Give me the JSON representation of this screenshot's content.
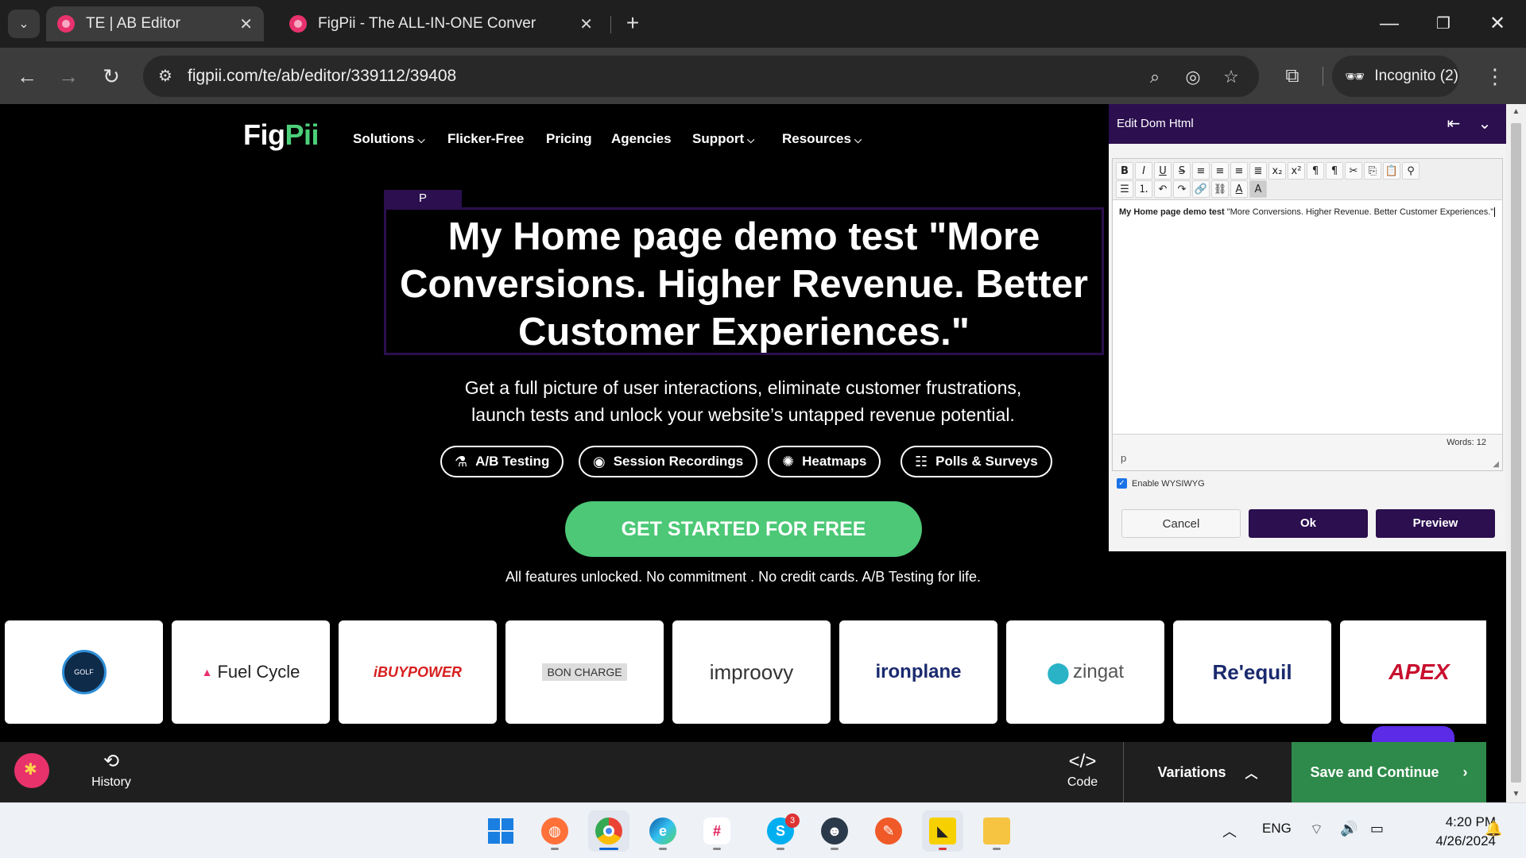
{
  "browser": {
    "tabs": [
      {
        "title": "TE | AB Editor",
        "active": true
      },
      {
        "title": "FigPii - The ALL-IN-ONE Conver",
        "active": false
      }
    ],
    "url": "figpii.com/te/ab/editor/339112/39408",
    "profile_label": "Incognito (2)"
  },
  "site": {
    "logo_fig": "Fig",
    "logo_pii": "Pii",
    "nav": [
      "Solutions",
      "Flicker-Free",
      "Pricing",
      "Agencies",
      "Support",
      "Resources"
    ],
    "selected_tag": "P",
    "headline": "My Home page demo test \"More Conversions. Higher Revenue. Better Customer Experiences.\"",
    "subhead_line1": "Get a full picture of user interactions, eliminate customer frustrations,",
    "subhead_line2": "launch tests and unlock your website’s untapped revenue potential.",
    "features": [
      {
        "label": "A/B Testing",
        "icon": "flask-icon"
      },
      {
        "label": "Session Recordings",
        "icon": "record-icon"
      },
      {
        "label": "Heatmaps",
        "icon": "heatmap-icon"
      },
      {
        "label": "Polls & Surveys",
        "icon": "survey-icon"
      }
    ],
    "cta": "GET STARTED FOR FREE",
    "cta_note": "All features unlocked. No commitment . No credit cards. A/B Testing for life.",
    "client_logos": [
      {
        "text": "GOLF"
      },
      {
        "text": "Fuel Cycle"
      },
      {
        "text": "iBUYPOWER"
      },
      {
        "text": "BON CHARGE"
      },
      {
        "text": "improovy"
      },
      {
        "text": "ironplane"
      },
      {
        "text": "zingat"
      },
      {
        "text": "Re'equil"
      },
      {
        "text": "APEX"
      }
    ]
  },
  "panel": {
    "title": "Edit Dom Html",
    "content_bold": "My Home page demo test",
    "content_rest": " \"More Conversions. Higher Revenue. Better Customer Experiences.\"",
    "path": "p",
    "words": "Words: 12",
    "wysiwyg_label": "Enable WYSIWYG",
    "cancel": "Cancel",
    "ok": "Ok",
    "preview": "Preview"
  },
  "editbar": {
    "history": "History",
    "code": "Code",
    "variations": "Variations",
    "save": "Save and Continue"
  },
  "taskbar": {
    "lang": "ENG",
    "time": "4:20 PM",
    "date": "4/26/2024",
    "skype_badge": "3"
  },
  "colors": {
    "brand_purple": "#2b0f4f",
    "brand_green": "#4cc876",
    "save_green": "#2e8a4a"
  }
}
